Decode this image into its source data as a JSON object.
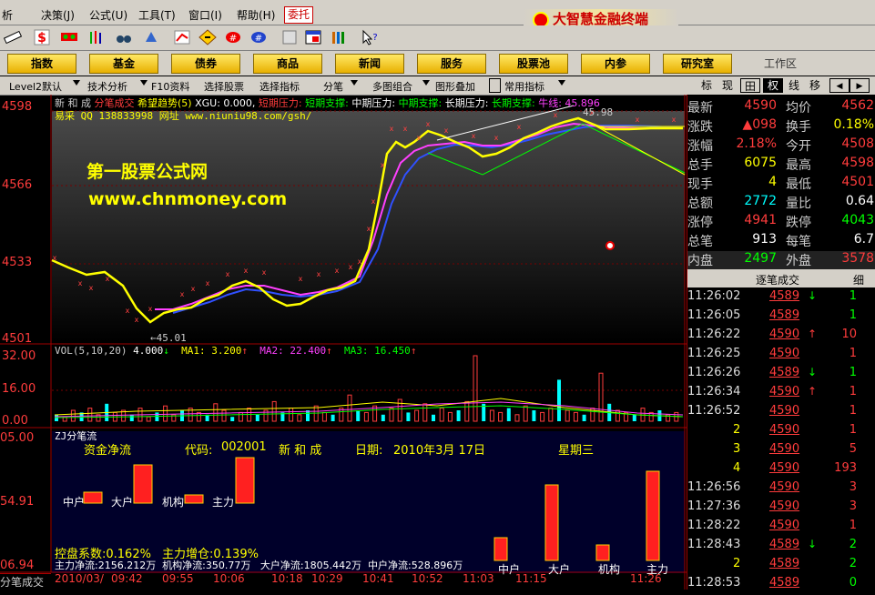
{
  "menu": [
    "析",
    "决策(J)",
    "公式(U)",
    "工具(T)",
    "窗口(I)",
    "帮助(H)"
  ],
  "menu_active": "委托",
  "brand": "大智慧金融终端",
  "func_buttons": [
    "指数",
    "基金",
    "债券",
    "商品",
    "新闻",
    "服务",
    "股票池",
    "内参",
    "研究室"
  ],
  "work_area": "工作区",
  "subbar": [
    "Level2默认",
    "技术分析",
    "F10资料",
    "选择股票",
    "选择指标",
    "分笔",
    "多图组合",
    "图形叠加",
    "常用指标"
  ],
  "right_tabs": [
    "标",
    "现",
    "田",
    "权",
    "线",
    "移"
  ],
  "price_axis": [
    "4598",
    "4566",
    "4533",
    "4501"
  ],
  "vol_axis": [
    "32.00",
    "16.00",
    "0.00"
  ],
  "zj_axis": [
    "05.00",
    "54.91",
    "06.94"
  ],
  "time_axis": [
    "2010/03/",
    "09:42",
    "09:55",
    "10:06",
    "10:18",
    "10:29",
    "10:41",
    "10:52",
    "11:03",
    "11:15",
    "11:26"
  ],
  "chart_header": {
    "name": "新 和 成",
    "indicator": "分笔成交",
    "trend": "希望趋势(5)",
    "xgu": "XGU: 0.000,",
    "short_press": "短期压力:",
    "short_support": "短期支撑:",
    "mid_press": "中期压力:",
    "mid_support": "中期支撑:",
    "long_press": "长期压力:",
    "long_support": "长期支撑:",
    "cow": "牛线: 45.896",
    "site": "易采 QQ 138833998 网址 www.niuniu98.com/gsh/"
  },
  "price_labels": {
    "high": "45.98",
    "low": "←45.01"
  },
  "watermark": {
    "line1": "第一股票公式网",
    "line2": "www.chnmoney.com"
  },
  "vol_header": {
    "label": "VOL(5,10,20)",
    "vol": "4.000",
    "ma1": "MA1: 3.200",
    "ma2": "MA2: 22.400",
    "ma3": "MA3: 16.450"
  },
  "zj": {
    "title": "ZJ分笔流",
    "heading": "资金净流",
    "code_label": "代码:",
    "code": "002001",
    "name": "新 和 成",
    "date_label": "日期:",
    "date": "2010年3月 17日",
    "weekday": "星期三",
    "bar_labels": [
      "中户",
      "大户",
      "机构",
      "主力"
    ],
    "bar_values": [
      0.12,
      0.42,
      0.09,
      0.5
    ],
    "right_values": [
      0.25,
      0.83,
      0.17,
      0.98
    ],
    "right_labels": [
      "中户",
      "大户",
      "机构",
      "主力"
    ],
    "control": "控盘系数:0.162%",
    "main_inc": "主力增仓:0.139%",
    "flows": "主力净流:2156.212万  机构净流:350.77万   大户净流:1805.442万  中户净流:528.896万"
  },
  "bottom_tab": "分笔成交",
  "quote": [
    {
      "l": "最新",
      "v": "4590",
      "c": "#ff3c3c",
      "l2": "均价",
      "v2": "4562",
      "c2": "#ff3c3c"
    },
    {
      "l": "涨跌",
      "v": "▲098",
      "c": "#ff3c3c",
      "l2": "换手",
      "v2": "0.18%",
      "c2": "#ffff00"
    },
    {
      "l": "涨幅",
      "v": "2.18%",
      "c": "#ff3c3c",
      "l2": "今开",
      "v2": "4508",
      "c2": "#ff3c3c"
    },
    {
      "l": "总手",
      "v": "6075",
      "c": "#ffff00",
      "l2": "最高",
      "v2": "4598",
      "c2": "#ff3c3c"
    },
    {
      "l": "现手",
      "v": "4",
      "c": "#ffff00",
      "l2": "最低",
      "v2": "4501",
      "c2": "#ff3c3c"
    },
    {
      "l": "总额",
      "v": "2772",
      "c": "#00ffff",
      "l2": "量比",
      "v2": "0.64",
      "c2": "#ffffff"
    },
    {
      "l": "涨停",
      "v": "4941",
      "c": "#ff3c3c",
      "l2": "跌停",
      "v2": "4043",
      "c2": "#00ff00"
    },
    {
      "l": "总笔",
      "v": "913",
      "c": "#ffffff",
      "l2": "每笔",
      "v2": "6.7",
      "c2": "#ffffff"
    },
    {
      "l": "内盘",
      "v": "2497",
      "c": "#00ff00",
      "l2": "外盘",
      "v2": "3578",
      "c2": "#ff3c3c"
    }
  ],
  "ticks_header": "逐笔成交",
  "ticks_tab2": "细",
  "ticks": [
    {
      "t": "11:26:02",
      "p": "4589",
      "a": "↓",
      "ac": "#00ff00",
      "v": "1",
      "vc": "#00ff00"
    },
    {
      "t": "11:26:05",
      "p": "4589",
      "a": "",
      "ac": "#fff",
      "v": "1",
      "vc": "#00ff00"
    },
    {
      "t": "11:26:22",
      "p": "4590",
      "a": "↑",
      "ac": "#ff3c3c",
      "v": "10",
      "vc": "#ff3c3c"
    },
    {
      "t": "11:26:25",
      "p": "4590",
      "a": "",
      "ac": "#fff",
      "v": "1",
      "vc": "#ff3c3c"
    },
    {
      "t": "11:26:26",
      "p": "4589",
      "a": "↓",
      "ac": "#00ff00",
      "v": "1",
      "vc": "#00ff00"
    },
    {
      "t": "11:26:34",
      "p": "4590",
      "a": "↑",
      "ac": "#ff3c3c",
      "v": "1",
      "vc": "#ff3c3c"
    },
    {
      "t": "11:26:52",
      "p": "4590",
      "a": "",
      "ac": "#fff",
      "v": "1",
      "vc": "#ff3c3c"
    },
    {
      "t": "2",
      "p": "4590",
      "a": "",
      "ac": "#fff",
      "v": "1",
      "vc": "#ff3c3c"
    },
    {
      "t": "3",
      "p": "4590",
      "a": "",
      "ac": "#fff",
      "v": "5",
      "vc": "#ff3c3c"
    },
    {
      "t": "4",
      "p": "4590",
      "a": "",
      "ac": "#fff",
      "v": "193",
      "vc": "#ff3c3c"
    },
    {
      "t": "11:26:56",
      "p": "4590",
      "a": "",
      "ac": "#fff",
      "v": "3",
      "vc": "#ff3c3c"
    },
    {
      "t": "11:27:36",
      "p": "4590",
      "a": "",
      "ac": "#fff",
      "v": "3",
      "vc": "#ff3c3c"
    },
    {
      "t": "11:28:22",
      "p": "4590",
      "a": "",
      "ac": "#fff",
      "v": "1",
      "vc": "#ff3c3c"
    },
    {
      "t": "11:28:43",
      "p": "4589",
      "a": "↓",
      "ac": "#00ff00",
      "v": "2",
      "vc": "#00ff00"
    },
    {
      "t": "2",
      "p": "4589",
      "a": "",
      "ac": "#fff",
      "v": "2",
      "vc": "#00ff00"
    },
    {
      "t": "11:28:53",
      "p": "4589",
      "a": "",
      "ac": "#fff",
      "v": "0",
      "vc": "#00ff00"
    }
  ],
  "colors": {
    "up": "#ff3c3c",
    "down": "#00ff00",
    "yellow": "#ffff00",
    "cyan": "#00ffff",
    "magenta": "#ff40ff",
    "blue": "#3050ff"
  }
}
